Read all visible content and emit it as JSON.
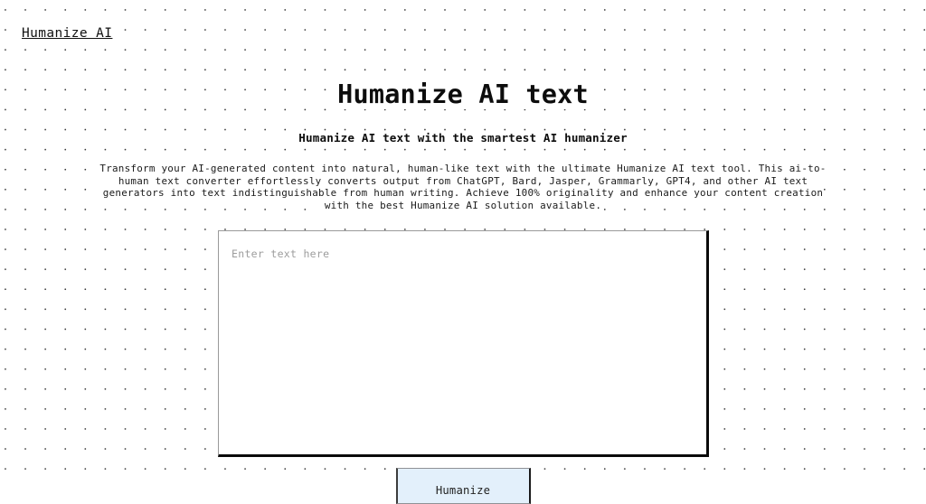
{
  "navbar": {
    "brand": "Humanize AI"
  },
  "hero": {
    "title": "Humanize AI text",
    "subtitle": "Humanize AI text with the smartest AI humanizer",
    "description": "Transform your AI-generated content into natural, human-like text with the ultimate Humanize AI text tool. This ai-to-human text converter effortlessly converts output from ChatGPT, Bard, Jasper, Grammarly, GPT4, and other AI text generators into text indistinguishable from human writing. Achieve 100% originality and enhance your content creation with the best Humanize AI solution available."
  },
  "editor": {
    "placeholder": "Enter text here",
    "value": ""
  },
  "actions": {
    "humanize_label": "Humanize"
  },
  "colors": {
    "page_background": "#ffffff",
    "dot_color": "#3a3a3a",
    "text": "#111111",
    "placeholder": "#9d9d9d",
    "button_background": "#e3f0fb",
    "button_border": "#8f9196",
    "input_border": "#9a9a9a",
    "input_shadow": "#0a0a0a"
  }
}
